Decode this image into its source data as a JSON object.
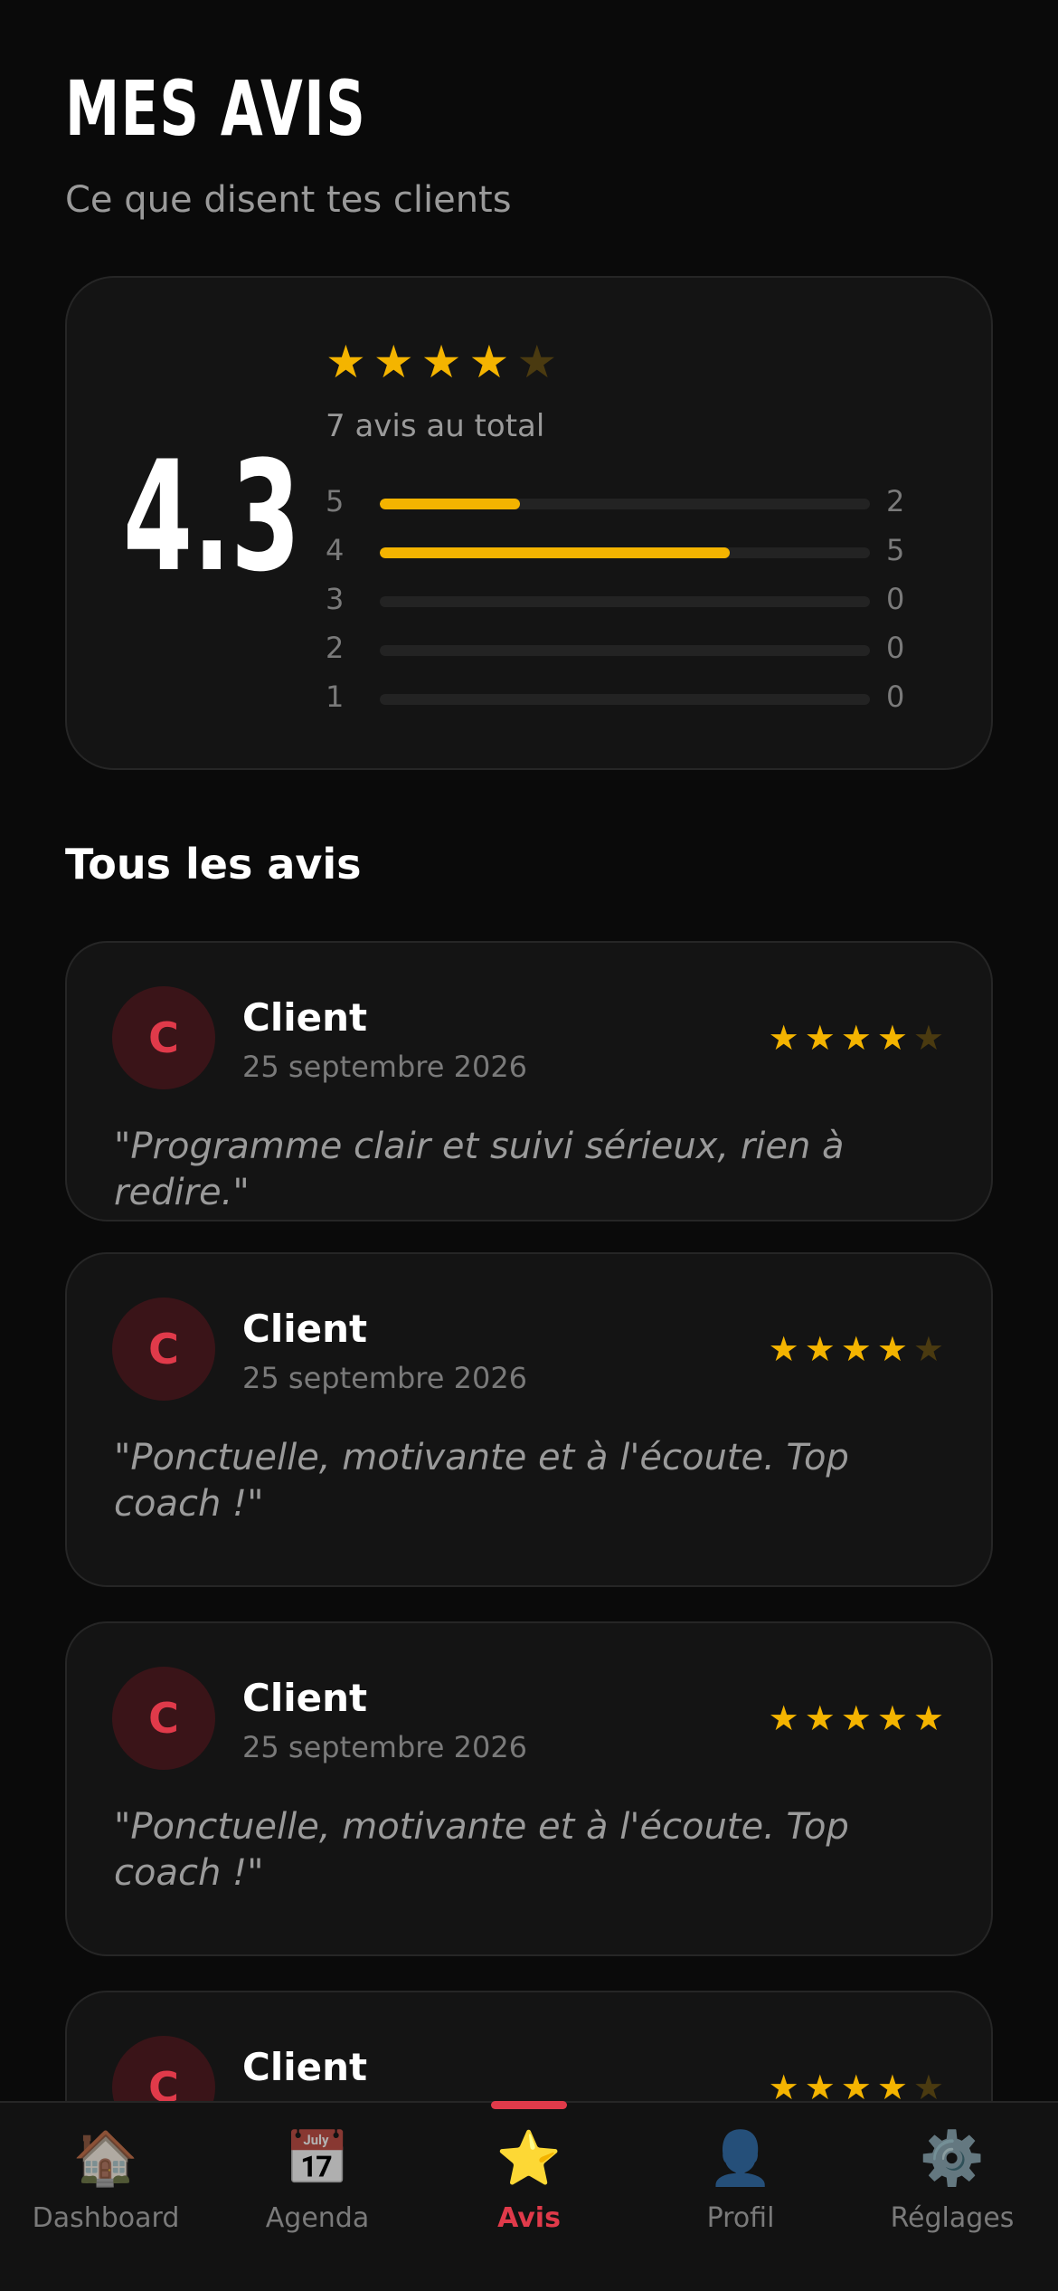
{
  "header": {
    "title": "MES AVIS",
    "subtitle": "Ce que disent tes clients"
  },
  "summary": {
    "score": "4.3",
    "stars_filled": 4,
    "stars_total": 5,
    "total_label": "7 avis au total",
    "distribution": [
      {
        "label": "5",
        "count": "2",
        "fraction": 0.286
      },
      {
        "label": "4",
        "count": "5",
        "fraction": 0.714
      },
      {
        "label": "3",
        "count": "0",
        "fraction": 0
      },
      {
        "label": "2",
        "count": "0",
        "fraction": 0
      },
      {
        "label": "1",
        "count": "0",
        "fraction": 0
      }
    ],
    "colors": {
      "star": "#f4b400",
      "star_off": "#4a3a10"
    }
  },
  "section": {
    "title": "Tous les avis"
  },
  "reviews": [
    {
      "initial": "C",
      "name": "Client",
      "date": "25 septembre 2026",
      "rating": 4,
      "text": "\"Programme clair et suivi sérieux, rien à redire.\""
    },
    {
      "initial": "C",
      "name": "Client",
      "date": "25 septembre 2026",
      "rating": 4,
      "text": "\"Ponctuelle, motivante et à l'écoute. Top coach !\""
    },
    {
      "initial": "C",
      "name": "Client",
      "date": "25 septembre 2026",
      "rating": 5,
      "text": "\"Ponctuelle, motivante et à l'écoute. Top coach !\""
    },
    {
      "initial": "C",
      "name": "Client",
      "date": "",
      "rating": 4,
      "text": ""
    }
  ],
  "nav": {
    "items": [
      {
        "label": "Dashboard",
        "icon": "house-icon",
        "glyph": "🏠"
      },
      {
        "label": "Agenda",
        "icon": "calendar-icon",
        "glyph": "📅"
      },
      {
        "label": "Avis",
        "icon": "star-icon",
        "glyph": "⭐"
      },
      {
        "label": "Profil",
        "icon": "user-icon",
        "glyph": "👤"
      },
      {
        "label": "Réglages",
        "icon": "gear-icon",
        "glyph": "⚙️"
      }
    ],
    "active_index": 2,
    "accent": "#e03a4a"
  }
}
